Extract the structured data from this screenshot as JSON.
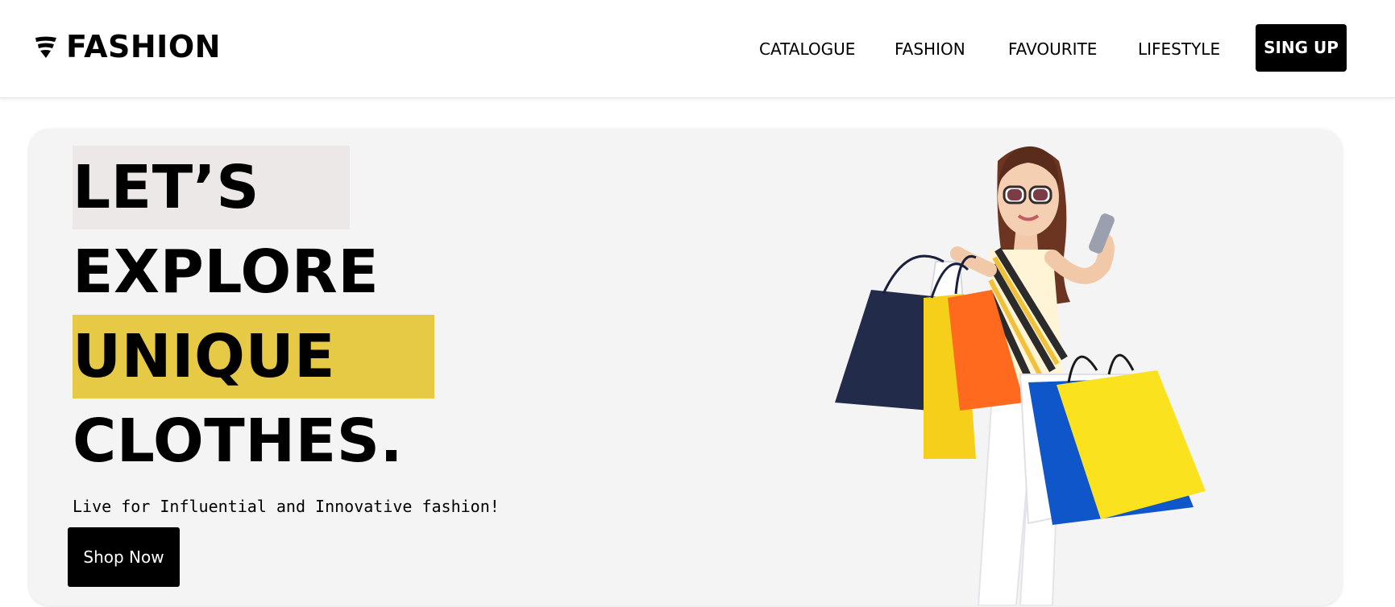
{
  "header": {
    "brand": "FASHION",
    "brand_icon": "fashion-logo-icon",
    "nav": [
      {
        "label": "CATALOGUE"
      },
      {
        "label": "FASHION"
      },
      {
        "label": "FAVOURITE"
      },
      {
        "label": "LIFESTYLE"
      }
    ],
    "signup_label": "SING UP"
  },
  "hero": {
    "headline": [
      "LET’S",
      "EXPLORE",
      "UNIQUE",
      "CLOTHES."
    ],
    "tagline": "Live for Influential and Innovative fashion!",
    "cta_label": "Shop Now",
    "image": "woman-with-shopping-bags"
  },
  "colors": {
    "accent_yellow": "#e6c945",
    "highlight_grey": "#ece8e7",
    "hero_background": "#f4f4f4",
    "button_black": "#000000"
  }
}
